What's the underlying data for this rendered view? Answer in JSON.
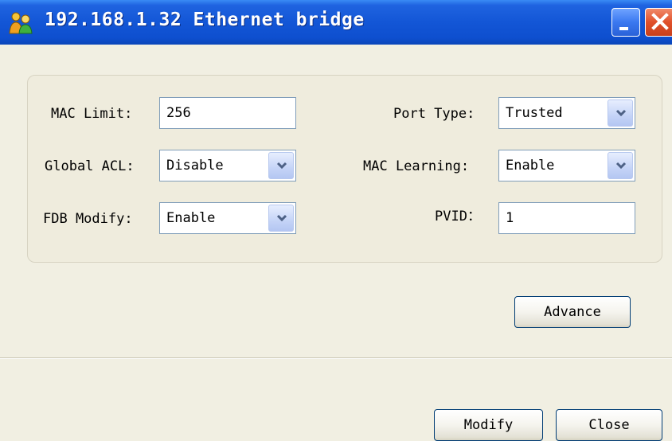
{
  "window": {
    "title": "192.168.1.32 Ethernet bridge"
  },
  "form": {
    "mac_limit": {
      "label": "MAC Limit:",
      "value": "256"
    },
    "port_type": {
      "label": "Port Type:",
      "value": "Trusted"
    },
    "global_acl": {
      "label": "Global ACL:",
      "value": "Disable"
    },
    "mac_learning": {
      "label": "MAC Learning:",
      "value": "Enable"
    },
    "fdb_modify": {
      "label": "FDB Modify:",
      "value": "Enable"
    },
    "pvid": {
      "label": "PVID：",
      "value": "1"
    }
  },
  "buttons": {
    "advance": "Advance",
    "modify": "Modify",
    "close": "Close"
  },
  "icons": {
    "app": "people-icon",
    "minimize": "minimize-icon",
    "close": "close-icon",
    "dropdown": "chevron-down-icon"
  },
  "colors": {
    "titlebar": "#1356d6",
    "window_bg": "#f1efe2",
    "close_button": "#e0502a"
  }
}
